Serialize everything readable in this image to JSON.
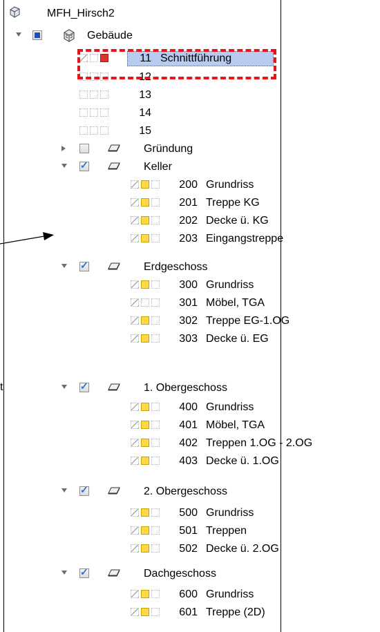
{
  "root": {
    "label": "MFH_Hirsch2",
    "icon": "building-icon"
  },
  "building": {
    "label": "Gebäude",
    "icon": "cube-icon"
  },
  "selected_structure": {
    "number": "11",
    "label": "Schnittführung"
  },
  "plain_items": [
    {
      "number": "12"
    },
    {
      "number": "13"
    },
    {
      "number": "14"
    },
    {
      "number": "15"
    }
  ],
  "floors": [
    {
      "label": "Gründung",
      "expanded": false,
      "checked": false,
      "items": []
    },
    {
      "label": "Keller",
      "expanded": true,
      "checked": true,
      "items": [
        {
          "number": "200",
          "label": "Grundriss",
          "icon": "yellow"
        },
        {
          "number": "201",
          "label": "Treppe KG",
          "icon": "yellow"
        },
        {
          "number": "202",
          "label": "Decke ü. KG",
          "icon": "yellow"
        },
        {
          "number": "203",
          "label": "Eingangstreppe",
          "icon": "yellow"
        }
      ]
    },
    {
      "label": "Erdgeschoss",
      "expanded": true,
      "checked": true,
      "items": [
        {
          "number": "300",
          "label": "Grundriss",
          "icon": "yellow"
        },
        {
          "number": "301",
          "label": "Möbel, TGA",
          "icon": "empty"
        },
        {
          "number": "302",
          "label": "Treppe EG-1.OG",
          "icon": "yellow"
        },
        {
          "number": "303",
          "label": "Decke ü. EG",
          "icon": "yellow"
        }
      ]
    },
    {
      "label": "1. Obergeschoss",
      "expanded": true,
      "checked": true,
      "items": [
        {
          "number": "400",
          "label": "Grundriss",
          "icon": "yellow"
        },
        {
          "number": "401",
          "label": "Möbel, TGA",
          "icon": "yellow"
        },
        {
          "number": "402",
          "label": "Treppen 1.OG - 2.OG",
          "icon": "yellow"
        },
        {
          "number": "403",
          "label": "Decke ü. 1.OG",
          "icon": "yellow"
        }
      ]
    },
    {
      "label": "2. Obergeschoss",
      "expanded": true,
      "checked": true,
      "items": [
        {
          "number": "500",
          "label": "Grundriss",
          "icon": "yellow"
        },
        {
          "number": "501",
          "label": "Treppen",
          "icon": "yellow"
        },
        {
          "number": "502",
          "label": "Decke ü. 2.OG",
          "icon": "yellow"
        }
      ]
    },
    {
      "label": "Dachgeschoss",
      "expanded": true,
      "checked": true,
      "items": [
        {
          "number": "600",
          "label": "Grundriss",
          "icon": "yellow"
        },
        {
          "number": "601",
          "label": "Treppe (2D)",
          "icon": "yellow"
        }
      ]
    }
  ],
  "annotation": {
    "edge_text": "t",
    "highlight_color": "#e8141b"
  },
  "colors": {
    "selection": "#b7cbee",
    "checkbox_blue": "#1e4fb5",
    "drawing_file": "#ffd84a",
    "active_file": "#d9352b"
  }
}
